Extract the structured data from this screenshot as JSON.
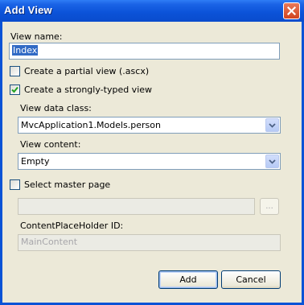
{
  "window": {
    "title": "Add View"
  },
  "form": {
    "view_name_label": "View name:",
    "view_name_value": "Index",
    "partial_view_label": "Create a partial view (.ascx)",
    "strongly_typed_label": "Create a strongly-typed view",
    "view_data_class_label": "View data class:",
    "view_data_class_value": "MvcApplication1.Models.person",
    "view_content_label": "View content:",
    "view_content_value": "Empty",
    "master_page_label": "Select master page",
    "master_page_path_value": "",
    "browse_label": "...",
    "content_placeholder_label": "ContentPlaceHolder ID:",
    "content_placeholder_value": "MainContent"
  },
  "checkboxes": {
    "partial_view": false,
    "strongly_typed": true,
    "master_page": false
  },
  "buttons": {
    "add": "Add",
    "cancel": "Cancel"
  },
  "colors": {
    "titlebar": "#0a53d6",
    "dialog_background": "#ece9d8",
    "selection": "#316ac5",
    "checkmark": "#21a121"
  }
}
